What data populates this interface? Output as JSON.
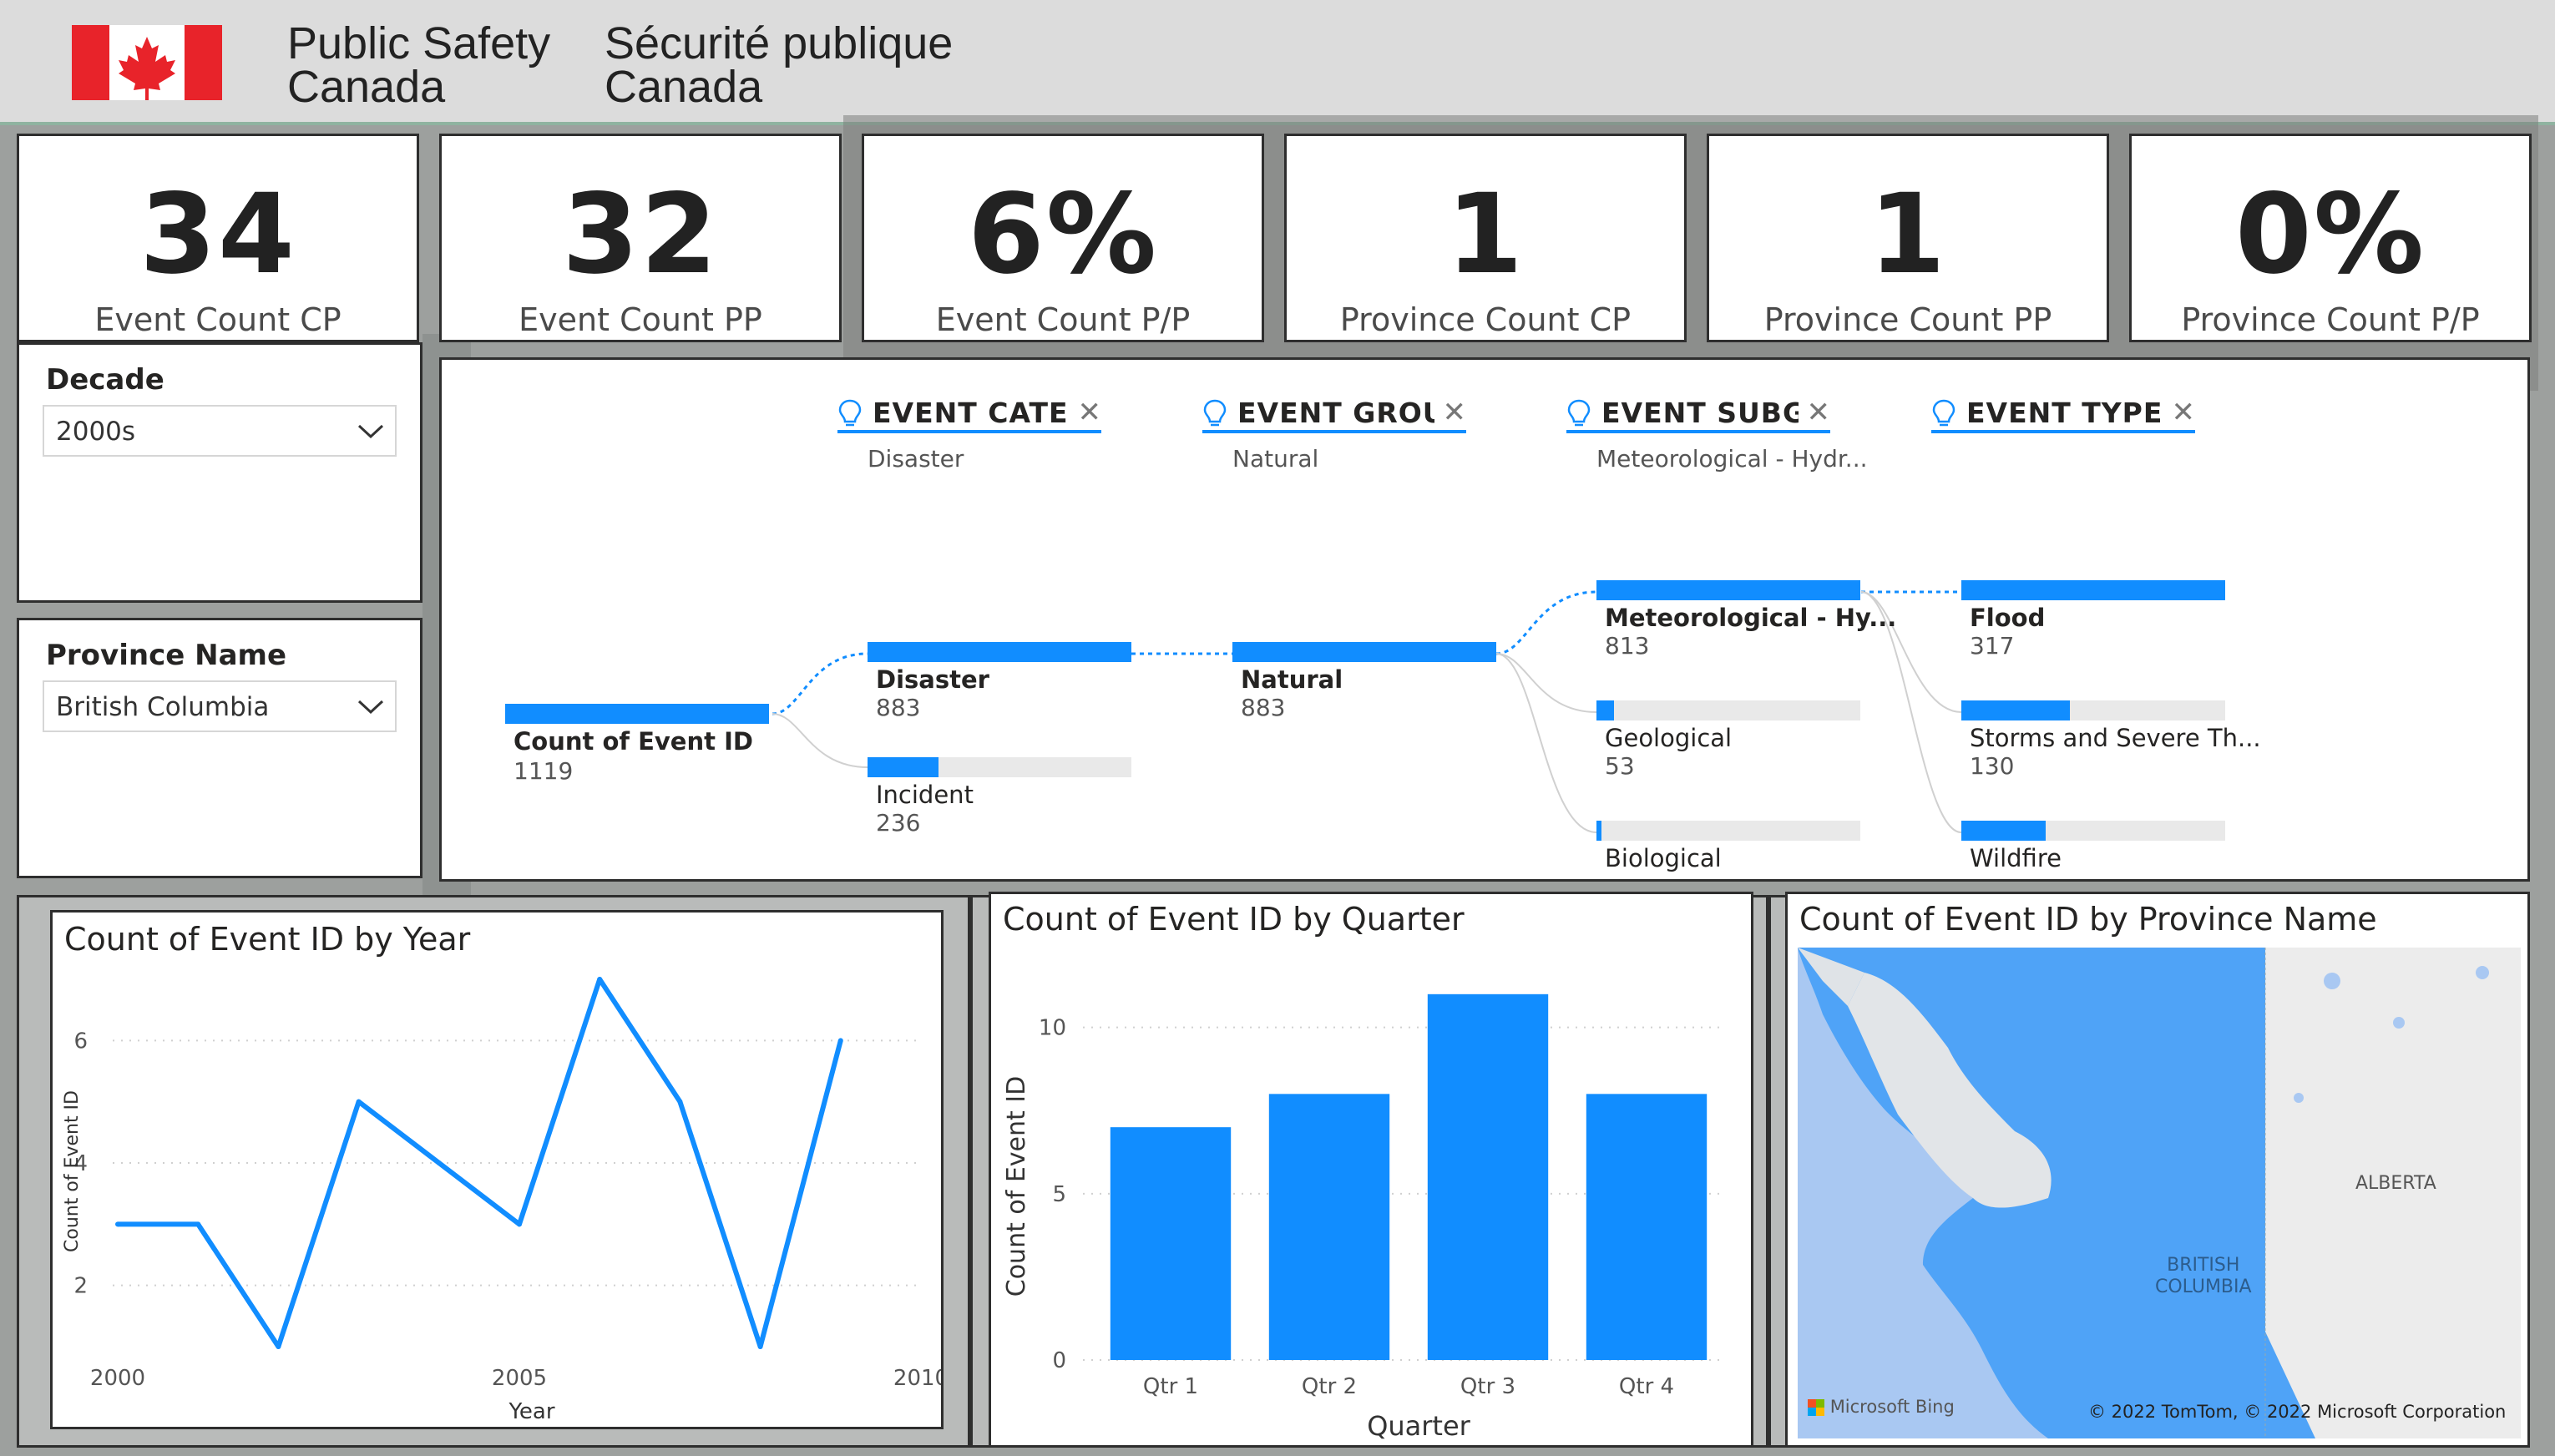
{
  "header": {
    "brand_en_line1": "Public Safety",
    "brand_en_line2": "Canada",
    "brand_fr_line1": "Sécurité publique",
    "brand_fr_line2": "Canada",
    "flag_icon": "canada-flag-icon",
    "flag_color": "#e8232a"
  },
  "kpis": [
    {
      "value": "34",
      "label": "Event Count CP"
    },
    {
      "value": "32",
      "label": "Event Count PP"
    },
    {
      "value": "6%",
      "label": "Event Count P/P"
    },
    {
      "value": "1",
      "label": "Province Count CP"
    },
    {
      "value": "1",
      "label": "Province Count PP"
    },
    {
      "value": "0%",
      "label": "Province Count P/P"
    }
  ],
  "slicers": {
    "decade": {
      "title": "Decade",
      "value": "2000s"
    },
    "province": {
      "title": "Province Name",
      "value": "British Columbia"
    }
  },
  "decomposition": {
    "root": {
      "name": "Count of Event ID",
      "value": "1119",
      "fraction": 1.0
    },
    "levels": [
      {
        "title": "EVENT CATEGORY",
        "filter": "Disaster",
        "nodes": [
          {
            "name": "Disaster",
            "value": "883",
            "fraction": 1.0,
            "selected": true
          },
          {
            "name": "Incident",
            "value": "236",
            "fraction": 0.27,
            "selected": false
          }
        ]
      },
      {
        "title": "EVENT GROUP",
        "filter": "Natural",
        "nodes": [
          {
            "name": "Natural",
            "value": "883",
            "fraction": 1.0,
            "selected": true
          }
        ]
      },
      {
        "title": "EVENT SUBGRO...",
        "filter": "Meteorological - Hydr...",
        "nodes": [
          {
            "name": "Meteorological - Hy...",
            "value": "813",
            "fraction": 1.0,
            "selected": true
          },
          {
            "name": "Geological",
            "value": "53",
            "fraction": 0.065,
            "selected": false
          },
          {
            "name": "Biological",
            "value": "",
            "fraction": 0.02,
            "selected": false
          }
        ]
      },
      {
        "title": "EVENT TYPE",
        "filter": "",
        "nodes": [
          {
            "name": "Flood",
            "value": "317",
            "fraction": 1.0,
            "selected": true
          },
          {
            "name": "Storms and Severe Th...",
            "value": "130",
            "fraction": 0.41,
            "selected": false
          },
          {
            "name": "Wildfire",
            "value": "",
            "fraction": 0.32,
            "selected": false
          }
        ]
      }
    ],
    "accent": "#118dff"
  },
  "year_chart": {
    "title": "Count of Event ID by Year"
  },
  "quarter_chart": {
    "title": "Count of Event ID by Quarter"
  },
  "map": {
    "title": "Count of Event ID by Province Name",
    "label_alberta": "ALBERTA",
    "label_bc_line1": "BRITISH",
    "label_bc_line2": "COLUMBIA",
    "bing_credit": "Microsoft Bing",
    "copyright": "© 2022 TomTom, © 2022 Microsoft Corporation",
    "highlight_color": "#4fa3f7"
  },
  "chart_data": [
    {
      "type": "line",
      "title": "Count of Event ID by Year",
      "xlabel": "Year",
      "ylabel": "Count of Event ID",
      "x": [
        2000,
        2001,
        2002,
        2003,
        2004,
        2005,
        2006,
        2007,
        2008,
        2009
      ],
      "values": [
        3,
        3,
        1,
        5,
        4,
        3,
        7,
        5,
        1,
        6
      ],
      "xticks": [
        "2000",
        "2005",
        "2010"
      ],
      "yticks": [
        "2",
        "4",
        "6"
      ],
      "xlim": [
        2000,
        2010
      ],
      "ylim": [
        1,
        7
      ],
      "grid": true,
      "color": "#118dff"
    },
    {
      "type": "bar",
      "title": "Count of Event ID by Quarter",
      "xlabel": "Quarter",
      "ylabel": "Count of Event ID",
      "categories": [
        "Qtr 1",
        "Qtr 2",
        "Qtr 3",
        "Qtr 4"
      ],
      "values": [
        7,
        8,
        11,
        8
      ],
      "yticks": [
        "0",
        "5",
        "10"
      ],
      "ylim": [
        0,
        12
      ],
      "grid": true,
      "color": "#118dff"
    }
  ]
}
